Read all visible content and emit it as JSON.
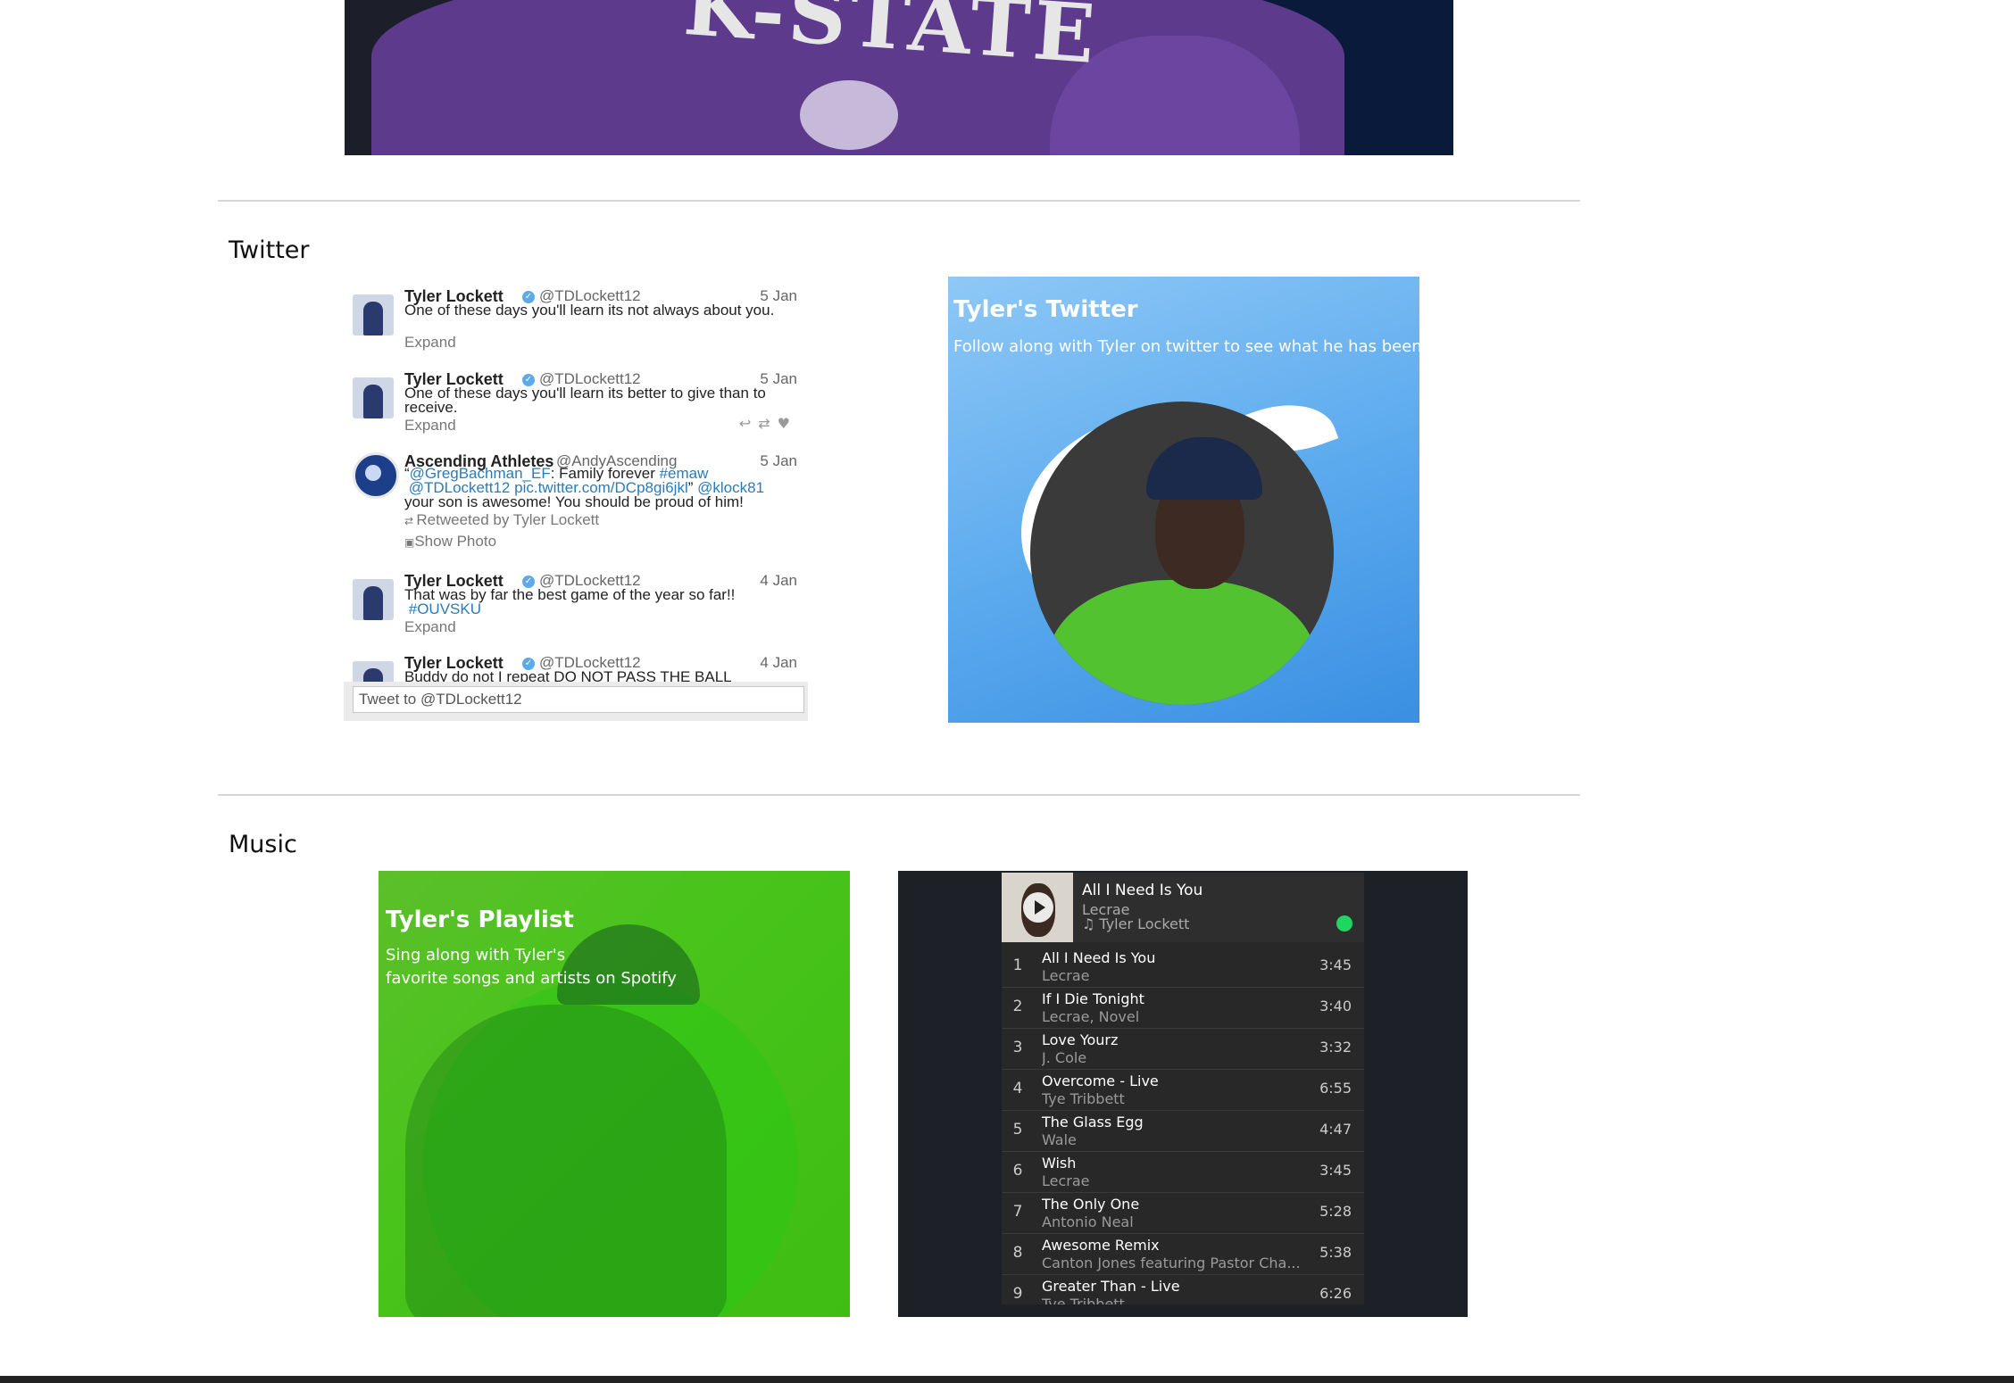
{
  "hero": {
    "text": "K-STATE"
  },
  "twitter": {
    "section_title": "Twitter",
    "tweets": [
      {
        "name": "Tyler Lockett",
        "handle": "@TDLockett12",
        "date": "5 Jan",
        "text": "One of these days you'll learn its not always about you.",
        "expand": "Expand"
      },
      {
        "name": "Tyler Lockett",
        "handle": "@TDLockett12",
        "date": "5 Jan",
        "text": "One of these days you'll learn its better to give than to receive.",
        "expand": "Expand"
      },
      {
        "name": "Ascending Athletes",
        "handle": "@AndyAscending",
        "date": "5 Jan",
        "text_pre": "“",
        "link1": "@GregBachman_EF",
        "text_mid": ": Family forever ",
        "link2": "#emaw",
        "link3": "@TDLockett12",
        "link4": "pic.twitter.com/DCp8gi6jkl",
        "text_mid2": "” ",
        "link5": "@klock81",
        "text_post": "your son is awesome! You should be proud of him!",
        "retweeted": "Retweeted by Tyler Lockett",
        "show_photo": "Show Photo"
      },
      {
        "name": "Tyler Lockett",
        "handle": "@TDLockett12",
        "date": "4 Jan",
        "text": "That was by far the best game of the year so far!!",
        "hashtag": "#OUVSKU",
        "expand": "Expand"
      },
      {
        "name": "Tyler Lockett",
        "handle": "@TDLockett12",
        "date": "4 Jan",
        "text": "Buddy do not I repeat DO NOT PASS THE BALL"
      }
    ],
    "tweet_box_placeholder": "Tweet to @TDLockett12",
    "card": {
      "title": "Tyler's Twitter",
      "subtitle": "Follow along with Tyler on twitter to see what he has been up t"
    }
  },
  "music": {
    "section_title": "Music",
    "card": {
      "title": "Tyler's Playlist",
      "subtitle_line1": "Sing along with Tyler's",
      "subtitle_line2": "favorite songs and artists on Spotify"
    },
    "player": {
      "now_playing_title": "All I Need Is You",
      "now_playing_artist": "Lecrae",
      "owner": "♫ Tyler Lockett",
      "tracks": [
        {
          "num": "1",
          "title": "All I Need Is You",
          "artist": "Lecrae",
          "duration": "3:45"
        },
        {
          "num": "2",
          "title": "If I Die Tonight",
          "artist": "Lecrae, Novel",
          "duration": "3:40"
        },
        {
          "num": "3",
          "title": "Love Yourz",
          "artist": "J. Cole",
          "duration": "3:32"
        },
        {
          "num": "4",
          "title": "Overcome - Live",
          "artist": "Tye Tribbett",
          "duration": "6:55"
        },
        {
          "num": "5",
          "title": "The Glass Egg",
          "artist": "Wale",
          "duration": "4:47"
        },
        {
          "num": "6",
          "title": "Wish",
          "artist": "Lecrae",
          "duration": "3:45"
        },
        {
          "num": "7",
          "title": "The Only One",
          "artist": "Antonio Neal",
          "duration": "5:28"
        },
        {
          "num": "8",
          "title": "Awesome Remix",
          "artist": "Canton Jones featuring Pastor Cha...",
          "duration": "5:38"
        },
        {
          "num": "9",
          "title": "Greater Than - Live",
          "artist": "Tye Tribbett",
          "duration": "6:26"
        }
      ]
    }
  },
  "colors": {
    "twitter_link": "#2b7bb9",
    "spotify_green": "#1ed760",
    "player_bg": "#282828"
  }
}
